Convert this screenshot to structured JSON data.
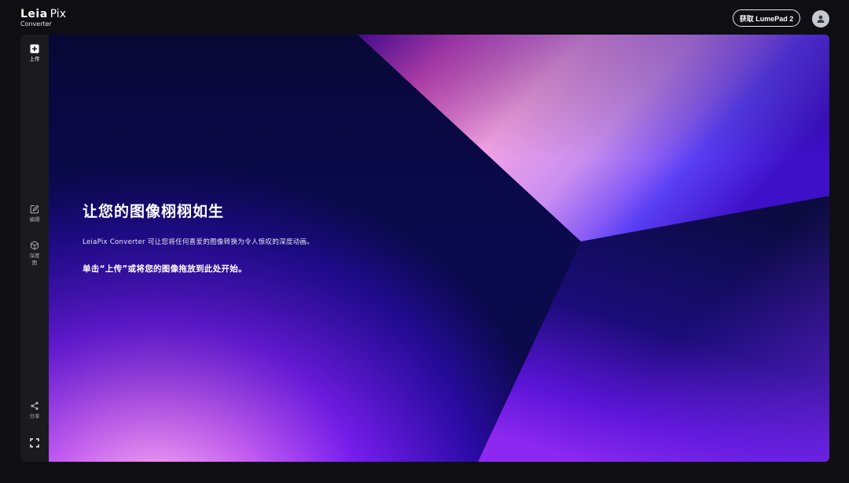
{
  "header": {
    "logo_brand": "Leia",
    "logo_product": "Pix",
    "logo_subtitle": "Converter",
    "get_button_label": "获取 LumePad 2"
  },
  "sidebar": {
    "items": [
      {
        "id": "upload",
        "label": "上传",
        "icon": "plus-square-icon"
      },
      {
        "id": "edit",
        "label": "编辑",
        "icon": "edit-icon"
      },
      {
        "id": "depth",
        "label": "深度图",
        "icon": "depth-cube-icon"
      },
      {
        "id": "share",
        "label": "分享",
        "icon": "share-icon"
      },
      {
        "id": "fullscreen",
        "label": "",
        "icon": "fullscreen-icon"
      }
    ]
  },
  "main": {
    "headline": "让您的图像栩栩如生",
    "description": "LeiaPix Converter 可让您将任何喜爱的图像转换为令人惊叹的深度动画。",
    "cta": "单击“上传”或将您的图像拖放到此处开始。"
  },
  "colors": {
    "background": "#0f0f13",
    "sidebar": "#1a1a1f",
    "accent_purple": "#7b2cf5",
    "accent_pink": "#f29ae0"
  }
}
